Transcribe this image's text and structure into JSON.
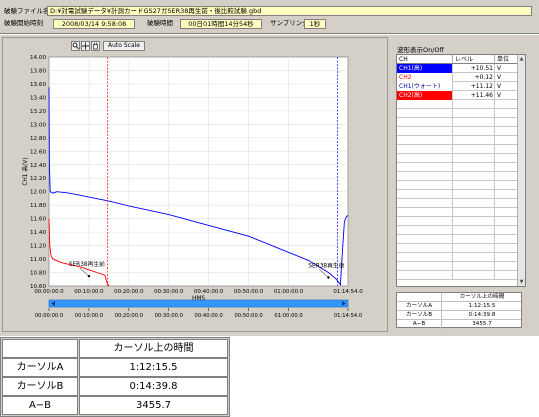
{
  "header": {
    "file_label": "破験ファイル名",
    "file_path": "D:¥対電試験データ¥計測カードGS27ガSER38再生前・後比較試験.gbd",
    "start_label": "破験開始時刻",
    "start_value": "2008/03/14 9:58:08",
    "duration_label": "破験時間",
    "duration_value": "00日01時間14分54秒",
    "sampling_label": "サンプリング間隔",
    "sampling_value": "1秒"
  },
  "toolbar": {
    "zoom_icon": "zoom-icon",
    "cross_icon": "crosshair-icon",
    "hand_icon": "pan-hand-icon",
    "auto_scale_label": "Auto Scale"
  },
  "chart_data": {
    "type": "line",
    "ylabel": "CH1 高(V)",
    "xlabel": "HMS",
    "ylim": [
      10.6,
      14.0
    ],
    "y_ticks": [
      "14.00",
      "13.80",
      "13.60",
      "13.40",
      "13.20",
      "13.00",
      "12.80",
      "12.60",
      "12.40",
      "12.20",
      "12.00",
      "11.80",
      "11.60",
      "11.40",
      "11.20",
      "11.00",
      "10.80",
      "10.60"
    ],
    "x_ticks": [
      "00:00:00.0",
      "00:10:00.0",
      "00:20:00.0",
      "00:30:00.0",
      "00:40:00.0",
      "00:50:00.0",
      "01:00:00.0",
      "01:14:54.0"
    ],
    "x_ticks_slider": [
      "00:00:00.0",
      "00:10:00.0",
      "00:20:00.0",
      "00:30:00.0",
      "00:40:00.0",
      "00:50:00.0",
      "01:00:00.0",
      "01:14:54.0"
    ],
    "xlim_minutes": [
      0,
      74.9
    ],
    "series": [
      {
        "color": "#0000ff",
        "x_minutes": [
          0,
          0.1,
          0.3,
          1,
          2,
          5,
          10,
          15,
          20,
          30,
          40,
          50,
          60,
          65,
          70,
          72,
          73,
          73.6,
          74,
          74.5,
          74.9
        ],
        "y": [
          13.55,
          12.4,
          12.0,
          11.98,
          12.0,
          11.98,
          11.92,
          11.86,
          11.79,
          11.66,
          11.5,
          11.34,
          11.1,
          10.98,
          10.8,
          10.7,
          10.62,
          11.2,
          11.55,
          11.63,
          11.65
        ]
      },
      {
        "color": "#ff0000",
        "x_minutes": [
          0,
          0.2,
          0.5,
          1,
          3,
          5,
          8,
          10,
          12,
          14,
          14.5,
          15
        ],
        "y": [
          11.6,
          11.2,
          11.05,
          11.0,
          10.95,
          10.92,
          10.88,
          10.84,
          10.8,
          10.76,
          10.65,
          10.6
        ]
      }
    ],
    "cursors": [
      {
        "name": "cursor-b",
        "color": "#ff0000",
        "x_minutes": 14.66
      },
      {
        "name": "cursor-a",
        "color": "#0000ff",
        "x_minutes": 72.26
      }
    ],
    "annotations": [
      {
        "text": "SER38再生前",
        "x_minutes": 10.0,
        "y": 10.88
      },
      {
        "text": "SER38再生後",
        "x_minutes": 70.0,
        "y": 10.86
      }
    ],
    "slider_range_minutes": [
      0,
      74.9
    ]
  },
  "side_panel": {
    "title": "波形表示On/Off",
    "headers": [
      "CH",
      "レベル",
      "単位"
    ],
    "rows": [
      {
        "ch": "CH1(高)",
        "level": "+10.51",
        "unit": "V",
        "bg": "#0000ff",
        "fg": "#ffffff"
      },
      {
        "ch": "CH2",
        "level": "+0.12",
        "unit": "V",
        "bg": "#ffffff",
        "fg": "#ff0000"
      },
      {
        "ch": "CH1(ウォート)",
        "level": "+11.12",
        "unit": "V",
        "bg": "#ffffff",
        "fg": "#0000a0"
      },
      {
        "ch": "CH2(高)",
        "level": "+11.46",
        "unit": "V",
        "bg": "#ff0000",
        "fg": "#ffffff"
      }
    ],
    "empty_rows": 20,
    "scroll_up": "▲",
    "scroll_down": "▼"
  },
  "cursor_table": {
    "header": "カーソル上の時間",
    "rows": [
      {
        "label": "カーソルA",
        "value": "1:12:15.5"
      },
      {
        "label": "カーソルB",
        "value": "0:14:39.8"
      },
      {
        "label": "A−B",
        "value": "3455.7"
      }
    ]
  },
  "colors": {
    "panel": "#d4d0c8",
    "field": "#ffffc0",
    "plot_bg": "#ffffff",
    "grid": "#e2e2e2",
    "slider": "#3399ff"
  }
}
